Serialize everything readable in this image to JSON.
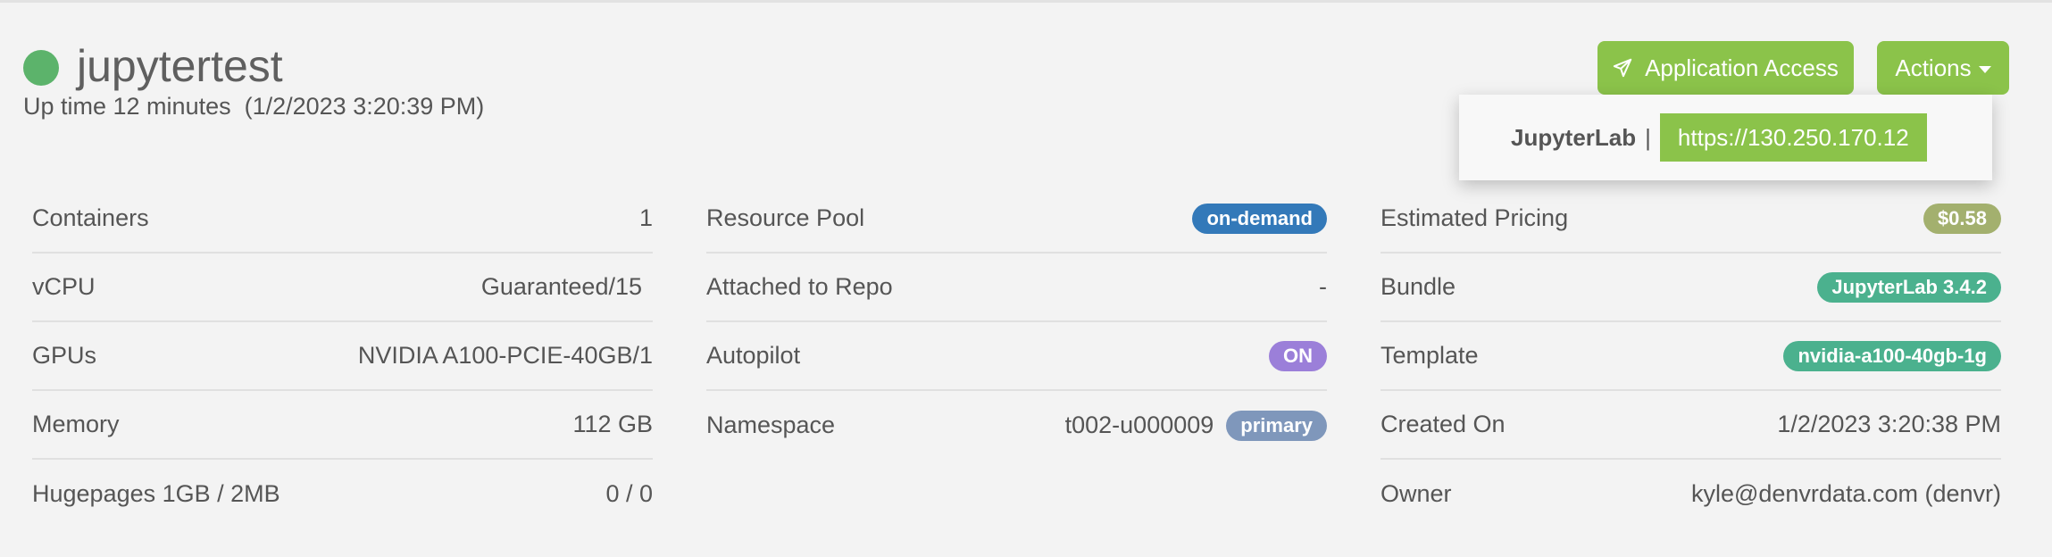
{
  "header": {
    "title": "jupytertest",
    "uptime": "Up time 12 minutes  (1/2/2023 3:20:39 PM)",
    "status_color": "#5cb36b"
  },
  "buttons": {
    "app_access_label": "Application Access",
    "app_access_icon": "paper-plane-icon",
    "actions_label": "Actions"
  },
  "popover": {
    "label": "JupyterLab",
    "separator": "|",
    "url": "https://130.250.170.12"
  },
  "col1": [
    {
      "label": "Containers",
      "value": "1"
    },
    {
      "label": "vCPU",
      "value": "Guaranteed/15"
    },
    {
      "label": "GPUs",
      "value": "NVIDIA A100-PCIE-40GB/1"
    },
    {
      "label": "Memory",
      "value": "112 GB"
    },
    {
      "label": "Hugepages 1GB / 2MB",
      "value": "0 / 0"
    }
  ],
  "col2": {
    "resource_pool": {
      "label": "Resource Pool",
      "badge": "on-demand"
    },
    "attached_repo": {
      "label": "Attached to Repo",
      "value": "-"
    },
    "autopilot": {
      "label": "Autopilot",
      "badge": "ON"
    },
    "namespace": {
      "label": "Namespace",
      "value": "t002-u000009",
      "badge": "primary"
    }
  },
  "col3": {
    "pricing": {
      "label": "Estimated Pricing",
      "badge": "$0.58"
    },
    "bundle": {
      "label": "Bundle",
      "badge": "JupyterLab 3.4.2"
    },
    "template": {
      "label": "Template",
      "badge": "nvidia-a100-40gb-1g"
    },
    "created": {
      "label": "Created On",
      "value": "1/2/2023 3:20:38 PM"
    },
    "owner": {
      "label": "Owner",
      "value": "kyle@denvrdata.com (denvr)"
    }
  },
  "colors": {
    "accent_green": "#8bc34a",
    "badge_blue": "#3379b9",
    "badge_purple": "#9b7fd9",
    "badge_steel": "#7f97bb",
    "badge_olive": "#a3b06e",
    "badge_teal": "#4bb18e"
  }
}
